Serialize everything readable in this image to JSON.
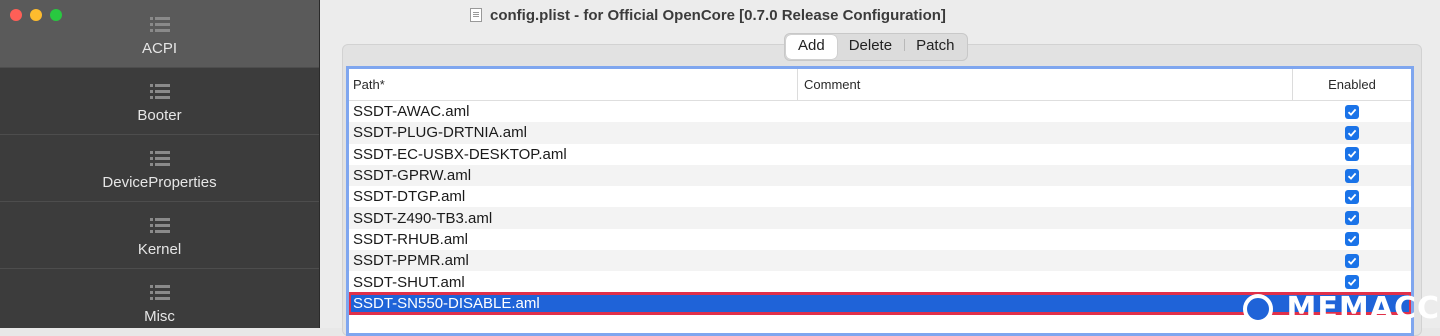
{
  "window": {
    "title": "config.plist - for Official OpenCore [0.7.0 Release Configuration]",
    "traffic_lights": [
      "#ff5f57",
      "#febc2e",
      "#28c840"
    ]
  },
  "sidebar": {
    "items": [
      {
        "label": "ACPI",
        "active": true
      },
      {
        "label": "Booter"
      },
      {
        "label": "DeviceProperties"
      },
      {
        "label": "Kernel"
      },
      {
        "label": "Misc"
      }
    ]
  },
  "segmented": {
    "add": "Add",
    "delete": "Delete",
    "patch": "Patch"
  },
  "table": {
    "headers": {
      "path": "Path*",
      "comment": "Comment",
      "enabled": "Enabled"
    },
    "rows": [
      {
        "path": "SSDT-AWAC.aml",
        "comment": "",
        "enabled": true
      },
      {
        "path": "SSDT-PLUG-DRTNIA.aml",
        "comment": "",
        "enabled": true
      },
      {
        "path": "SSDT-EC-USBX-DESKTOP.aml",
        "comment": "",
        "enabled": true
      },
      {
        "path": "SSDT-GPRW.aml",
        "comment": "",
        "enabled": true
      },
      {
        "path": "SSDT-DTGP.aml",
        "comment": "",
        "enabled": true
      },
      {
        "path": "SSDT-Z490-TB3.aml",
        "comment": "",
        "enabled": true
      },
      {
        "path": "SSDT-RHUB.aml",
        "comment": "",
        "enabled": true
      },
      {
        "path": "SSDT-PPMR.aml",
        "comment": "",
        "enabled": true
      },
      {
        "path": "SSDT-SHUT.aml",
        "comment": "",
        "enabled": true
      },
      {
        "path": "SSDT-SN550-DISABLE.aml",
        "comment": "",
        "enabled": true,
        "selected": true
      }
    ]
  },
  "watermark": "MEMACC"
}
